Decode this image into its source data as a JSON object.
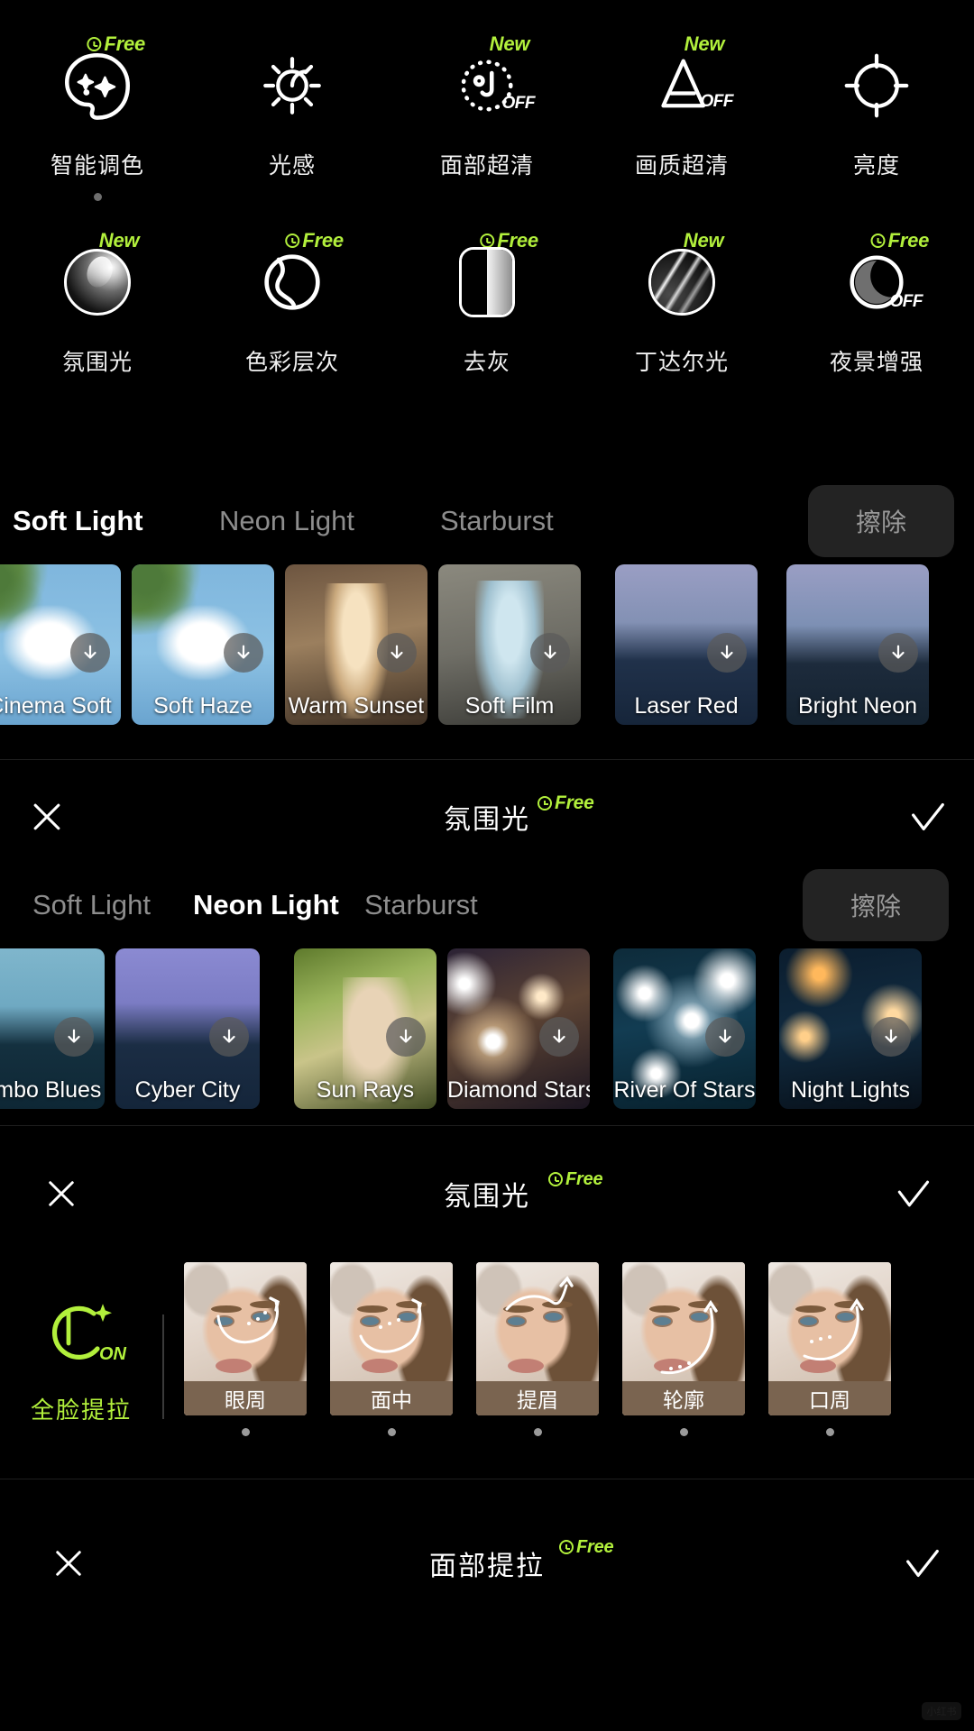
{
  "tool_rows": [
    {
      "row_name": "adjust-tools-row-1",
      "tools": [
        {
          "label": "智能调色",
          "badge": "Free",
          "badge_type": "free",
          "icon": "palette-sparkle-icon",
          "state": "",
          "has_dot": true
        },
        {
          "label": "光感",
          "badge": "",
          "badge_type": "",
          "icon": "sun-icon",
          "state": "",
          "has_dot": false
        },
        {
          "label": "面部超清",
          "badge": "New",
          "badge_type": "new",
          "icon": "face-hd-dotted-icon",
          "state": "OFF",
          "has_dot": false
        },
        {
          "label": "画质超清",
          "badge": "New",
          "badge_type": "new",
          "icon": "image-hd-triangle-icon",
          "state": "OFF",
          "has_dot": false
        },
        {
          "label": "亮度",
          "badge": "",
          "badge_type": "",
          "icon": "brightness-icon",
          "state": "",
          "has_dot": false
        }
      ]
    },
    {
      "row_name": "adjust-tools-row-2",
      "tools": [
        {
          "label": "氛围光",
          "badge": "New",
          "badge_type": "new",
          "icon": "ambient-light-sphere-icon",
          "state": "",
          "has_dot": false
        },
        {
          "label": "色彩层次",
          "badge": "Free",
          "badge_type": "free",
          "icon": "color-gradation-icon",
          "state": "",
          "has_dot": false
        },
        {
          "label": "去灰",
          "badge": "Free",
          "badge_type": "free",
          "icon": "dehaze-icon",
          "state": "",
          "has_dot": false
        },
        {
          "label": "丁达尔光",
          "badge": "New",
          "badge_type": "new",
          "icon": "tyndall-light-icon",
          "state": "",
          "has_dot": false
        },
        {
          "label": "夜景增强",
          "badge": "Free",
          "badge_type": "free",
          "icon": "night-boost-moon-icon",
          "state": "OFF",
          "has_dot": false
        }
      ]
    }
  ],
  "panel_soft_light": {
    "tabs": [
      {
        "label": "Soft Light",
        "active": true
      },
      {
        "label": "Neon Light",
        "active": false
      },
      {
        "label": "Starburst",
        "active": false
      }
    ],
    "erase_label": "擦除",
    "filters": [
      {
        "name": "Cinema Soft",
        "art": "art-dove"
      },
      {
        "name": "Soft Haze",
        "art": "art-dove"
      },
      {
        "name": "Warm Sunset",
        "art": "art-warm"
      },
      {
        "name": "Soft Film",
        "art": "art-film"
      },
      {
        "name": "Laser Red",
        "art": "art-laser"
      },
      {
        "name": "Bright Neon",
        "art": "art-light"
      }
    ]
  },
  "panel_neon_light": {
    "header": {
      "title": "氛围光",
      "badge": "Free",
      "close_icon": "close-icon",
      "confirm_icon": "check-icon"
    },
    "tabs": [
      {
        "label": "Soft Light",
        "active": false
      },
      {
        "label": "Neon Light",
        "active": true
      },
      {
        "label": "Starburst",
        "active": false
      }
    ],
    "erase_label": "擦除",
    "filters": [
      {
        "name": "Mambo Blues",
        "art": "art-mambo"
      },
      {
        "name": "Cyber City",
        "art": "art-cyber"
      },
      {
        "name": "Sun Rays",
        "art": "art-sun"
      },
      {
        "name": "Diamond Stars",
        "art": "art-dia"
      },
      {
        "name": "River Of Stars",
        "art": "art-river"
      },
      {
        "name": "Night Lights",
        "art": "art-night"
      }
    ]
  },
  "panel_face_lift": {
    "header": {
      "title": "氛围光",
      "badge": "Free",
      "close_icon": "close-icon",
      "confirm_icon": "check-icon"
    },
    "toggle": {
      "label": "全脸提拉",
      "state": "ON",
      "icon": "full-face-lift-icon",
      "color": "#b2f03c"
    },
    "items": [
      {
        "name": "眼周",
        "arrow": "eye-area-arrow"
      },
      {
        "name": "面中",
        "arrow": "mid-face-arrow"
      },
      {
        "name": "提眉",
        "arrow": "brow-lift-arrow"
      },
      {
        "name": "轮廓",
        "arrow": "contour-arrow"
      },
      {
        "name": "口周",
        "arrow": "mouth-area-arrow"
      }
    ]
  },
  "panel_bottom": {
    "header": {
      "title": "面部提拉",
      "badge": "Free",
      "close_icon": "close-icon",
      "confirm_icon": "check-icon"
    }
  },
  "watermark": {
    "text": "小红书"
  },
  "colors": {
    "accent_green": "#b2f03c",
    "background": "#000000",
    "text_primary": "#ffffff",
    "text_muted": "#8d8d8d",
    "erase_button_bg": "#232323",
    "facelift_label_bg": "#7a6450"
  }
}
